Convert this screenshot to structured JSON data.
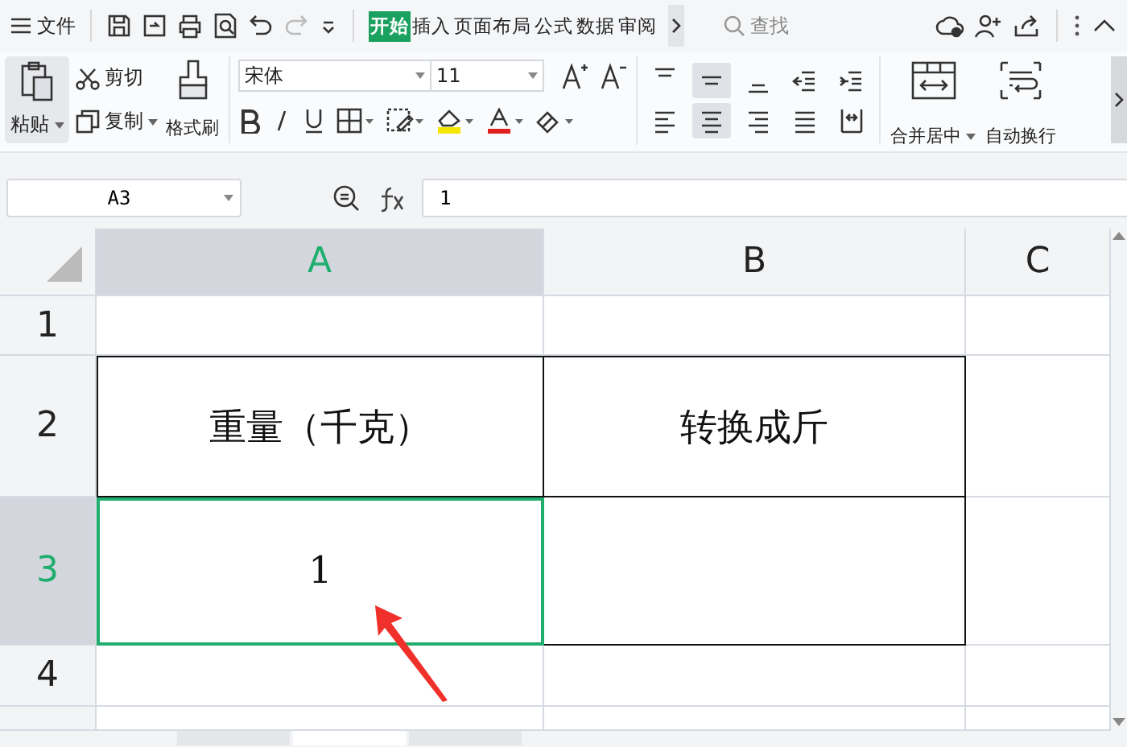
{
  "menu_bar": {
    "menu_label": "文件",
    "tabs": [
      {
        "label": "开始",
        "selected": true
      },
      {
        "label": "插入",
        "selected": false
      },
      {
        "label": "页面布局",
        "selected": false
      },
      {
        "label": "公式",
        "selected": false
      },
      {
        "label": "数据",
        "selected": false
      },
      {
        "label": "审阅",
        "selected": false
      }
    ],
    "search": {
      "placeholder": "查找"
    }
  },
  "ribbon": {
    "paste": "粘贴",
    "cut": "剪切",
    "copy": "复制",
    "format_painter": "格式刷",
    "font_name": "宋体",
    "font_size": "11",
    "merge_center": "合并居中",
    "wrap_text": "自动换行",
    "alignment_buttons": [
      {
        "kind": "top",
        "selected": false
      },
      {
        "kind": "middle",
        "selected": true
      },
      {
        "kind": "bottom",
        "selected": false
      },
      {
        "kind": "outdent",
        "selected": false
      },
      {
        "kind": "indent",
        "selected": false
      },
      {
        "kind": "left",
        "selected": false
      },
      {
        "kind": "center",
        "selected": true
      },
      {
        "kind": "right",
        "selected": false
      },
      {
        "kind": "justify",
        "selected": false
      },
      {
        "kind": "distributed",
        "selected": false
      }
    ]
  },
  "formula_bar": {
    "cell_ref": "A3",
    "value": "1"
  },
  "sheet": {
    "columns": [
      {
        "label": "A",
        "selected": true
      },
      {
        "label": "B",
        "selected": false
      },
      {
        "label": "C",
        "selected": false
      }
    ],
    "rows": [
      {
        "label": "1",
        "selected": false
      },
      {
        "label": "2",
        "selected": false,
        "cells": [
          "重量（千克）",
          "转换成斤"
        ]
      },
      {
        "label": "3",
        "selected": true,
        "cells": [
          "1"
        ]
      },
      {
        "label": "4",
        "selected": false
      }
    ]
  },
  "sheet_tabs": [
    {
      "selected": false
    },
    {
      "selected": true
    },
    {
      "selected": false
    }
  ]
}
